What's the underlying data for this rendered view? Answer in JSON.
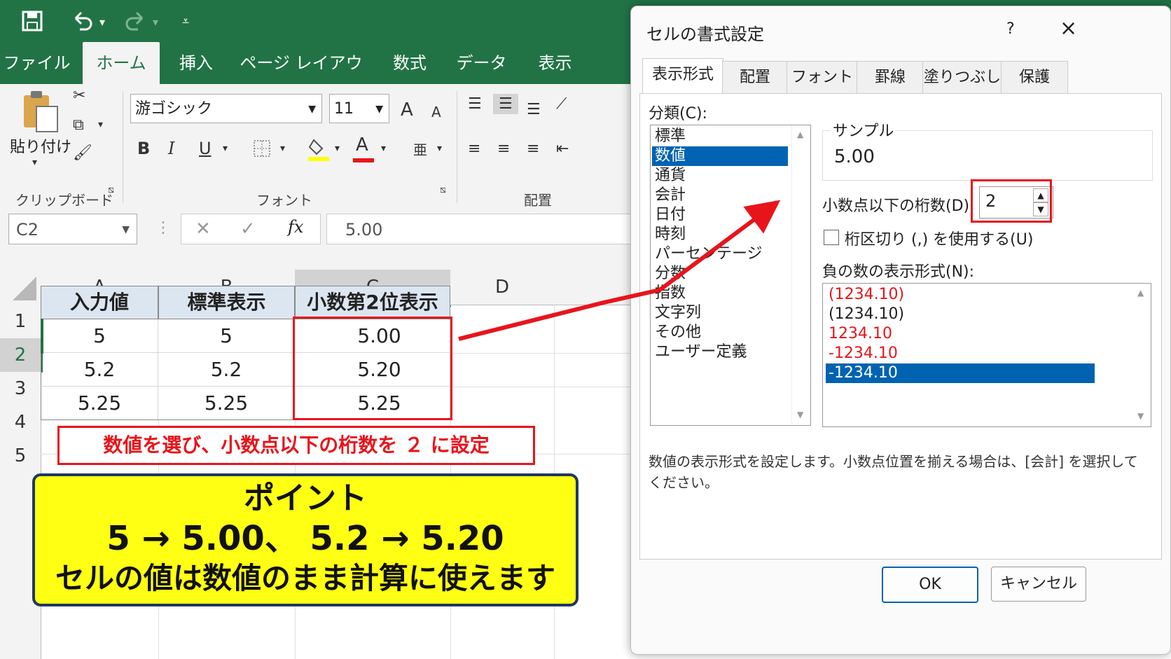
{
  "excel": {
    "tabs": [
      "ファイル",
      "ホーム",
      "挿入",
      "ページ レイアウト",
      "数式",
      "データ",
      "表示"
    ],
    "active_tab": "ホーム",
    "clipboard": {
      "paste_label": "貼り付け",
      "group_label": "クリップボード"
    },
    "font": {
      "name": "游ゴシック",
      "size": "11",
      "group_label": "フォント",
      "bold": "B",
      "italic": "I",
      "underline": "U",
      "increase": "A",
      "decrease": "A",
      "color_letter": "A"
    },
    "alignment": {
      "group_label": "配置"
    },
    "name_box": "C2",
    "fx_label": "fx",
    "formula_value": "5.00",
    "columns": [
      "A",
      "B",
      "C",
      "D"
    ],
    "rows": [
      "1",
      "2",
      "3",
      "4",
      "5"
    ],
    "header_row": [
      "入力値",
      "標準表示",
      "小数第2位表示"
    ],
    "data_rows": [
      [
        "5",
        "5",
        "5.00"
      ],
      [
        "5.2",
        "5.2",
        "5.20"
      ],
      [
        "5.25",
        "5.25",
        "5.25"
      ]
    ]
  },
  "annotations": {
    "callout": "数値を選び、小数点以下の桁数を ２ に設定",
    "point_title": "ポイント",
    "point_line1": "5 → 5.00、 5.2 → 5.20",
    "point_line2": "セルの値は数値のまま計算に使えます",
    "accent_red": "#e8141b",
    "accent_yellow": "#ffff14"
  },
  "dialog": {
    "title": "セルの書式設定",
    "help": "?",
    "close": "×",
    "tabs": [
      "表示形式",
      "配置",
      "フォント",
      "罫線",
      "塗りつぶし",
      "保護"
    ],
    "category_label": "分類(C):",
    "categories": [
      "標準",
      "数値",
      "通貨",
      "会計",
      "日付",
      "時刻",
      "パーセンテージ",
      "分数",
      "指数",
      "文字列",
      "その他",
      "ユーザー定義"
    ],
    "selected_category": "数値",
    "sample_label": "サンプル",
    "sample_value": "5.00",
    "decimal_label": "小数点以下の桁数(D):",
    "decimal_value": "2",
    "separator_label": "桁区切り (,) を使用する(U)",
    "negative_label": "負の数の表示形式(N):",
    "negatives": [
      "(1234.10)",
      "(1234.10)",
      "1234.10",
      "-1234.10",
      "-1234.10"
    ],
    "negative_colors": [
      "#e8141b",
      "#222222",
      "#e8141b",
      "#e8141b",
      "#ffffff"
    ],
    "description": "数値の表示形式を設定します。小数点位置を揃える場合は、[会計] を選択してください。",
    "ok": "OK",
    "cancel": "キャンセル"
  }
}
